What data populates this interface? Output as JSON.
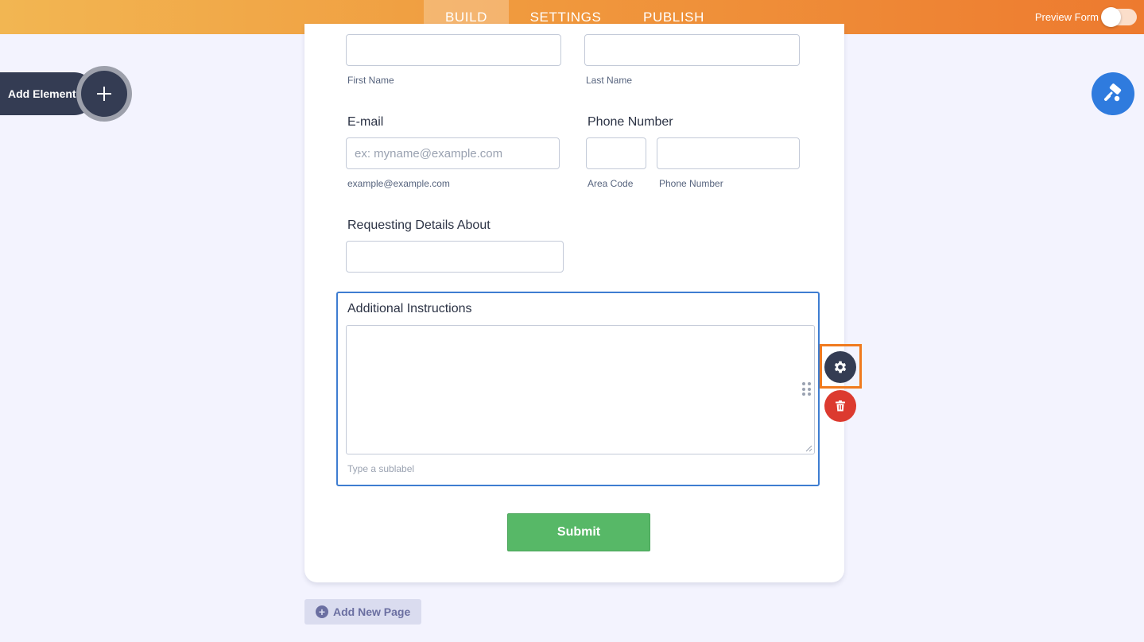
{
  "header": {
    "tabs": [
      {
        "label": "BUILD",
        "active": true
      },
      {
        "label": "SETTINGS",
        "active": false
      },
      {
        "label": "PUBLISH",
        "active": false
      }
    ],
    "preview_label": "Preview Form",
    "preview_enabled": false
  },
  "sidebar": {
    "add_element_label": "Add Element",
    "add_element_icon": "plus-icon"
  },
  "designer": {
    "icon": "paint-roller-icon"
  },
  "form": {
    "name_field": {
      "first_sublabel": "First Name",
      "last_sublabel": "Last Name"
    },
    "email_field": {
      "label": "E-mail",
      "placeholder": "ex: myname@example.com",
      "sublabel": "example@example.com"
    },
    "phone_field": {
      "label": "Phone Number",
      "area_sublabel": "Area Code",
      "number_sublabel": "Phone Number"
    },
    "requesting_field": {
      "label": "Requesting Details About"
    },
    "instructions_field": {
      "label": "Additional Instructions",
      "sublabel_placeholder": "Type a sublabel"
    },
    "submit_label": "Submit"
  },
  "field_tools": {
    "settings_icon": "gear-icon",
    "delete_icon": "trash-icon"
  },
  "footer": {
    "add_page_label": "Add New Page"
  },
  "colors": {
    "accent_orange": "#ed7a2f",
    "selection_blue": "#3e7dd1",
    "submit_green": "#57b867",
    "delete_red": "#dc3a2f",
    "dark_navy": "#343c53"
  }
}
